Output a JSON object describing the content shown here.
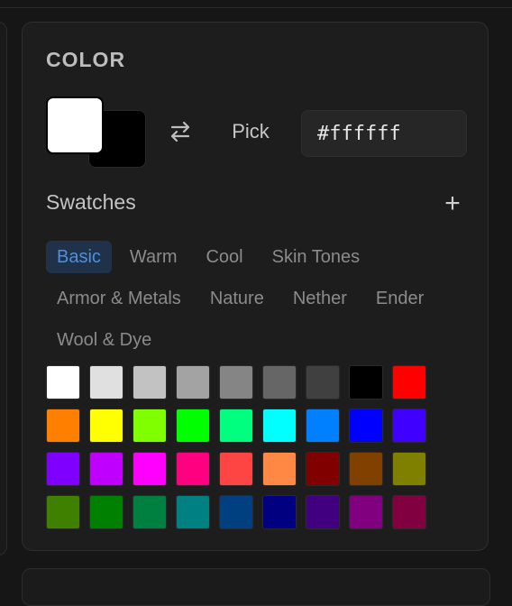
{
  "color_panel": {
    "title": "COLOR",
    "primary_color": "#ffffff",
    "secondary_color": "#000000",
    "pick_label": "Pick",
    "hex_value": "#ffffff",
    "swap_icon": "swap-arrows-icon"
  },
  "swatches": {
    "title": "Swatches",
    "add_label": "+",
    "tabs": [
      {
        "label": "Basic",
        "active": true
      },
      {
        "label": "Warm",
        "active": false
      },
      {
        "label": "Cool",
        "active": false
      },
      {
        "label": "Skin Tones",
        "active": false
      },
      {
        "label": "Armor & Metals",
        "active": false
      },
      {
        "label": "Nature",
        "active": false
      },
      {
        "label": "Nether",
        "active": false
      },
      {
        "label": "Ender",
        "active": false
      },
      {
        "label": "Wool & Dye",
        "active": false
      }
    ],
    "colors": [
      "#ffffff",
      "#e0e0e0",
      "#c2c2c2",
      "#a3a3a3",
      "#858585",
      "#666666",
      "#404040",
      "#000000",
      "#ff0000",
      "#ff7f00",
      "#ffff00",
      "#7fff00",
      "#00ff00",
      "#00ff7f",
      "#00ffff",
      "#007fff",
      "#0000ff",
      "#4000ff",
      "#8000ff",
      "#bf00ff",
      "#ff00ff",
      "#ff0080",
      "#ff4444",
      "#ff8844",
      "#800000",
      "#804000",
      "#808000",
      "#408000",
      "#008000",
      "#008040",
      "#008080",
      "#004080",
      "#000080",
      "#400080",
      "#800080",
      "#800040"
    ]
  }
}
